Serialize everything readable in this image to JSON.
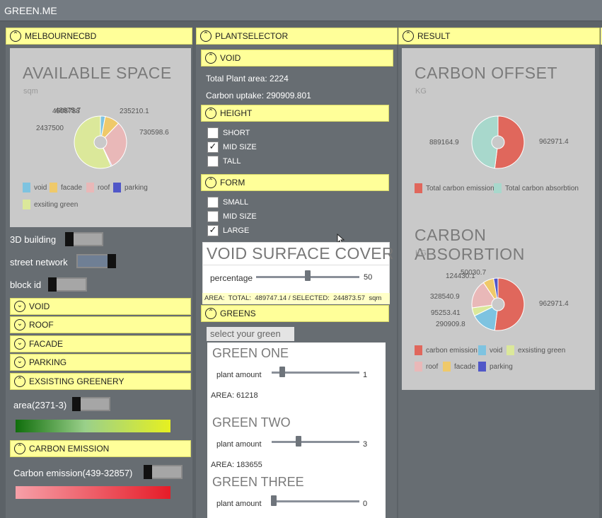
{
  "app": {
    "title": "GREEN.ME"
  },
  "panels": {
    "melbourne": {
      "header": "MELBOURNECBD",
      "available_space": {
        "title": "AVAILABLE SPACE",
        "unit": "sqm",
        "labels": [
          "235210.1",
          "730598.6",
          "2437500",
          "48875.7",
          "4508788"
        ],
        "legend": [
          "void",
          "facade",
          "roof",
          "parking",
          "exsiting green"
        ]
      },
      "toggles": {
        "building": "3D building",
        "street": "street network",
        "block": "block id"
      },
      "sections": [
        "VOID",
        "ROOF",
        "FACADE",
        "PARKING"
      ],
      "existing_greenery": {
        "header": "EXSISTING GREENERY",
        "label": "area(2371-3)"
      },
      "carbon_emission": {
        "header": "CARBON EMISSION",
        "label": "Carbon emission(439-32857)"
      }
    },
    "plantselector": {
      "header": "PLANTSELECTOR",
      "void": {
        "header": "VOID",
        "total_area": "Total Plant area: 2224",
        "carbon_uptake": "Carbon uptake: 290909.801"
      },
      "height": {
        "header": "HEIGHT",
        "options": [
          "SHORT",
          "MID SIZE",
          "TALL"
        ],
        "checked": [
          false,
          true,
          false
        ]
      },
      "form": {
        "header": "FORM",
        "options": [
          "SMALL",
          "MID SIZE",
          "LARGE"
        ],
        "checked": [
          false,
          false,
          true
        ]
      },
      "surface": {
        "title": "VOID SURFACE COVER",
        "label": "percentage",
        "value": "50",
        "value_fraction": 0.5,
        "area": "AREA:  TOTAL:  489747.14 / SELECTED:  244873.57  sqm"
      },
      "greens": {
        "header": "GREENS",
        "select": "select your green",
        "items": [
          {
            "title": "GREEN ONE",
            "label": "plant amount",
            "value": "1",
            "area": "AREA: 61218"
          },
          {
            "title": "GREEN TWO",
            "label": "plant amount",
            "value": "3",
            "area": "AREA: 183655"
          },
          {
            "title": "GREEN THREE",
            "label": "plant amount",
            "value": "0"
          }
        ]
      }
    },
    "result": {
      "header": "RESULT",
      "carbon_offset": {
        "title": "CARBON OFFSET",
        "unit": "KG",
        "labels": [
          "889164.9",
          "962971.4"
        ],
        "legend": [
          "Total carbon emission",
          "Total carbon absorbtion"
        ]
      },
      "carbon_absorption": {
        "title": "CARBON ABSORBTION",
        "unit": "KG",
        "labels": [
          "50030.7",
          "124430.1",
          "328540.9",
          "95253.41",
          "290909.8",
          "962971.4"
        ],
        "legend": [
          "carbon emission",
          "void",
          "exsisting green",
          "roof",
          "facade",
          "parking"
        ]
      }
    }
  },
  "colors": {
    "accent_yellow": "#ffff99",
    "void": "#7ec3e0",
    "facade": "#efc96a",
    "roof": "#e9b8b8",
    "parking": "#5057c8",
    "existing_green": "#dbe89a",
    "emission": "#e0675c",
    "absorption": "#a8d8cc"
  },
  "chart_data": [
    {
      "type": "pie",
      "title": "AVAILABLE SPACE",
      "categories": [
        "void",
        "facade",
        "roof",
        "parking",
        "exsiting green"
      ],
      "values": [
        235210.1,
        730598.6,
        2437500,
        48875.7,
        4508788
      ]
    },
    {
      "type": "pie",
      "title": "CARBON OFFSET",
      "categories": [
        "Total carbon emission",
        "Total carbon absorbtion"
      ],
      "values": [
        962971.4,
        889164.9
      ]
    },
    {
      "type": "pie",
      "title": "CARBON ABSORBTION",
      "categories": [
        "carbon emission",
        "void",
        "exsisting green",
        "roof",
        "facade",
        "parking"
      ],
      "values": [
        962971.4,
        290909.8,
        95253.41,
        328540.9,
        124430.1,
        50030.7
      ]
    }
  ]
}
